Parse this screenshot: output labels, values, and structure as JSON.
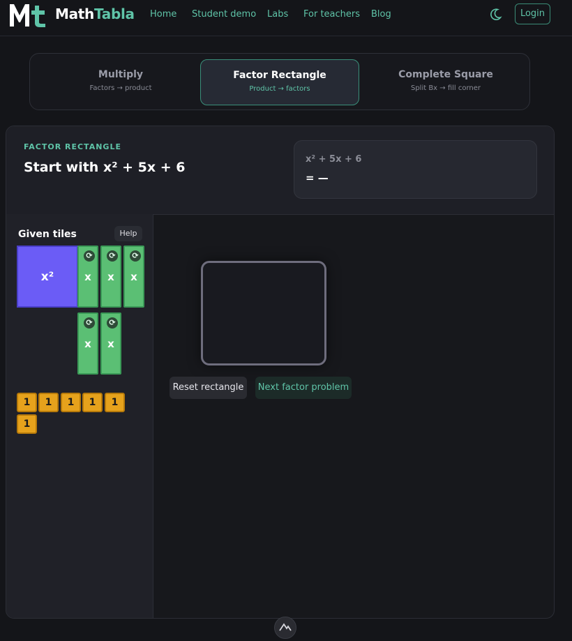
{
  "nav": {
    "brand_part1": "Math",
    "brand_part2": "Tabla",
    "links": [
      "Home",
      "Student demo",
      "Labs",
      "For teachers",
      "Blog"
    ],
    "login_label": "Login",
    "theme_icon": "moon-icon"
  },
  "modes": [
    {
      "title": "Multiply",
      "subtitle": "Factors → product"
    },
    {
      "title": "Factor Rectangle",
      "subtitle": "Product → factors"
    },
    {
      "title": "Complete Square",
      "subtitle": "Split Bx → fill corner"
    }
  ],
  "card": {
    "eyebrow": "FACTOR RECTANGLE",
    "headline": "Start with x² + 5x + 6",
    "expression": "x² + 5x + 6",
    "result": "= —"
  },
  "tiles": {
    "title": "Given tiles",
    "help_label": "Help",
    "x2_label": "x²",
    "x_label": "x",
    "one_label": "1",
    "rotate_icon": "rotate-icon",
    "counts": {
      "x2": 1,
      "x": 5,
      "one": 6
    }
  },
  "actions": {
    "reset_label": "Reset rectangle",
    "next_label": "Next factor problem"
  },
  "colors": {
    "accent": "#5fc4a8",
    "x2_tile": "#6b5cf6",
    "x_tile": "#5bbf74",
    "one_tile": "#e6a21c"
  }
}
